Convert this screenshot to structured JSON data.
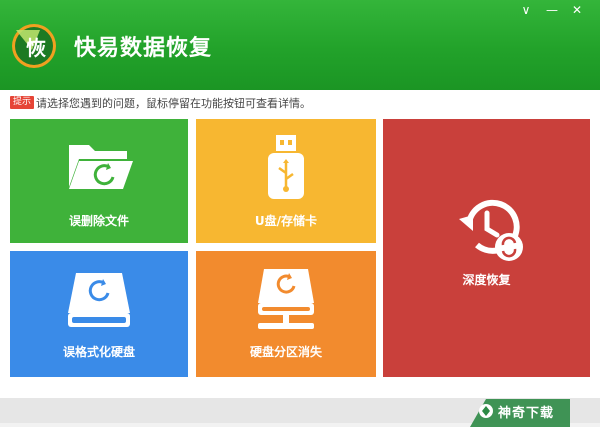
{
  "app": {
    "title": "快易数据恢复",
    "logo_char": "恢"
  },
  "window_controls": {
    "dropdown": "∨",
    "minimize": "—",
    "close": "✕"
  },
  "hint": {
    "badge": "提示",
    "text": "请选择您遇到的问题，鼠标停留在功能按钮可查看详情。"
  },
  "tiles": {
    "deleted_files": {
      "label": "误删除文件",
      "color": "#3fb23a",
      "icon": "folder-refresh-icon"
    },
    "usb_card": {
      "label": "U盘/存储卡",
      "color": "#f7b731",
      "icon": "usb-drive-icon"
    },
    "deep_recovery": {
      "label": "深度恢复",
      "color": "#c9403b",
      "icon": "history-refresh-icon"
    },
    "formatted_disk": {
      "label": "误格式化硬盘",
      "color": "#3a8be8",
      "icon": "hard-disk-refresh-icon"
    },
    "partition_lost": {
      "label": "硬盘分区消失",
      "color": "#f28b2e",
      "icon": "network-disk-refresh-icon"
    }
  },
  "watermark": {
    "text": "神奇下载",
    "icon": "watermark-logo-icon"
  }
}
